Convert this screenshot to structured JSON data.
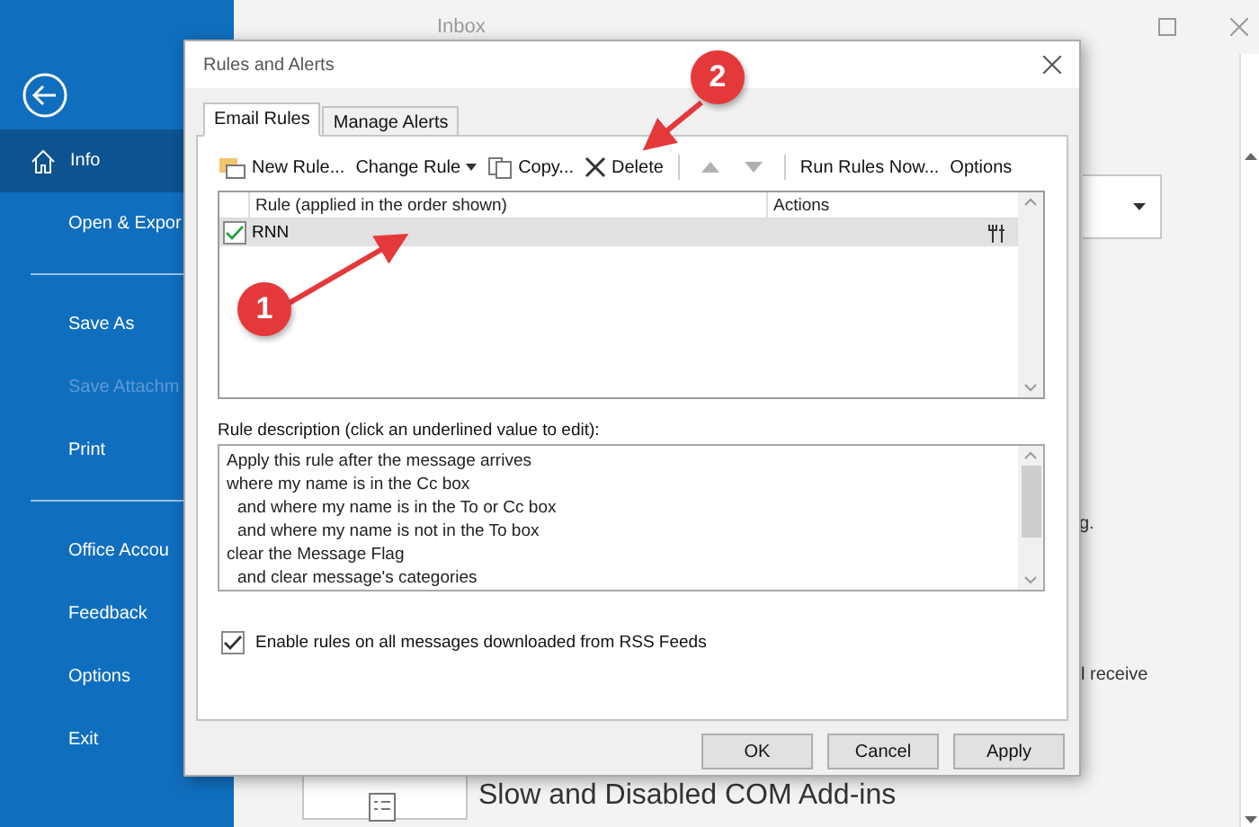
{
  "app": {
    "title": "Inbox"
  },
  "sidebar": {
    "groups": [
      {
        "items": [
          {
            "label": "Info",
            "selected": true,
            "disabled": false
          },
          {
            "label": "Open & Expor",
            "selected": false,
            "disabled": false
          }
        ]
      },
      {
        "items": [
          {
            "label": "Save As",
            "selected": false,
            "disabled": false
          },
          {
            "label": "Save Attachm",
            "selected": false,
            "disabled": true
          },
          {
            "label": "Print",
            "selected": false,
            "disabled": false
          }
        ]
      },
      {
        "items": [
          {
            "label": "Office Accou",
            "selected": false,
            "disabled": false
          },
          {
            "label": "Feedback",
            "selected": false,
            "disabled": false
          },
          {
            "label": "Options",
            "selected": false,
            "disabled": false
          },
          {
            "label": "Exit",
            "selected": false,
            "disabled": false
          }
        ]
      }
    ]
  },
  "background": {
    "texts": [
      "g.",
      "l receive"
    ],
    "addin_card": {
      "title": "Slow and Disabled COM Add-ins"
    }
  },
  "dialog": {
    "title": "Rules and Alerts",
    "tabs": [
      {
        "label": "Email Rules",
        "selected": true
      },
      {
        "label": "Manage Alerts",
        "selected": false
      }
    ],
    "toolbar": [
      {
        "kind": "new",
        "label": "New Rule...",
        "disabled": false
      },
      {
        "kind": "change",
        "label": "Change Rule",
        "disabled": false
      },
      {
        "kind": "copy",
        "label": "Copy...",
        "disabled": false
      },
      {
        "kind": "delete",
        "label": "Delete",
        "disabled": false
      },
      {
        "kind": "up",
        "disabled": true
      },
      {
        "kind": "down",
        "disabled": true
      },
      {
        "kind": "run",
        "label": "Run Rules Now...",
        "disabled": false
      },
      {
        "kind": "options",
        "label": "Options",
        "disabled": false
      }
    ],
    "columns": [
      "Rule (applied in the order shown)",
      "Actions"
    ],
    "rules": [
      {
        "name": "RNN",
        "checked": true,
        "selected": true
      }
    ],
    "description_label": "Rule description (click an underlined value to edit):",
    "description": [
      {
        "text": "Apply this rule after the message arrives"
      },
      {
        "text": "where my name is in the Cc box",
        "children": [
          {
            "text": "and where my name is in the To or Cc box"
          },
          {
            "text": "and where my name is not in the To box"
          }
        ]
      },
      {
        "text": "clear the Message Flag",
        "children": [
          {
            "text": "and clear message's categories"
          }
        ]
      }
    ],
    "rss_option": {
      "label": "Enable rules on all messages downloaded from RSS Feeds",
      "checked": true
    },
    "buttons": [
      "OK",
      "Cancel",
      "Apply"
    ]
  },
  "annotations": [
    {
      "number": "1"
    },
    {
      "number": "2"
    }
  ]
}
